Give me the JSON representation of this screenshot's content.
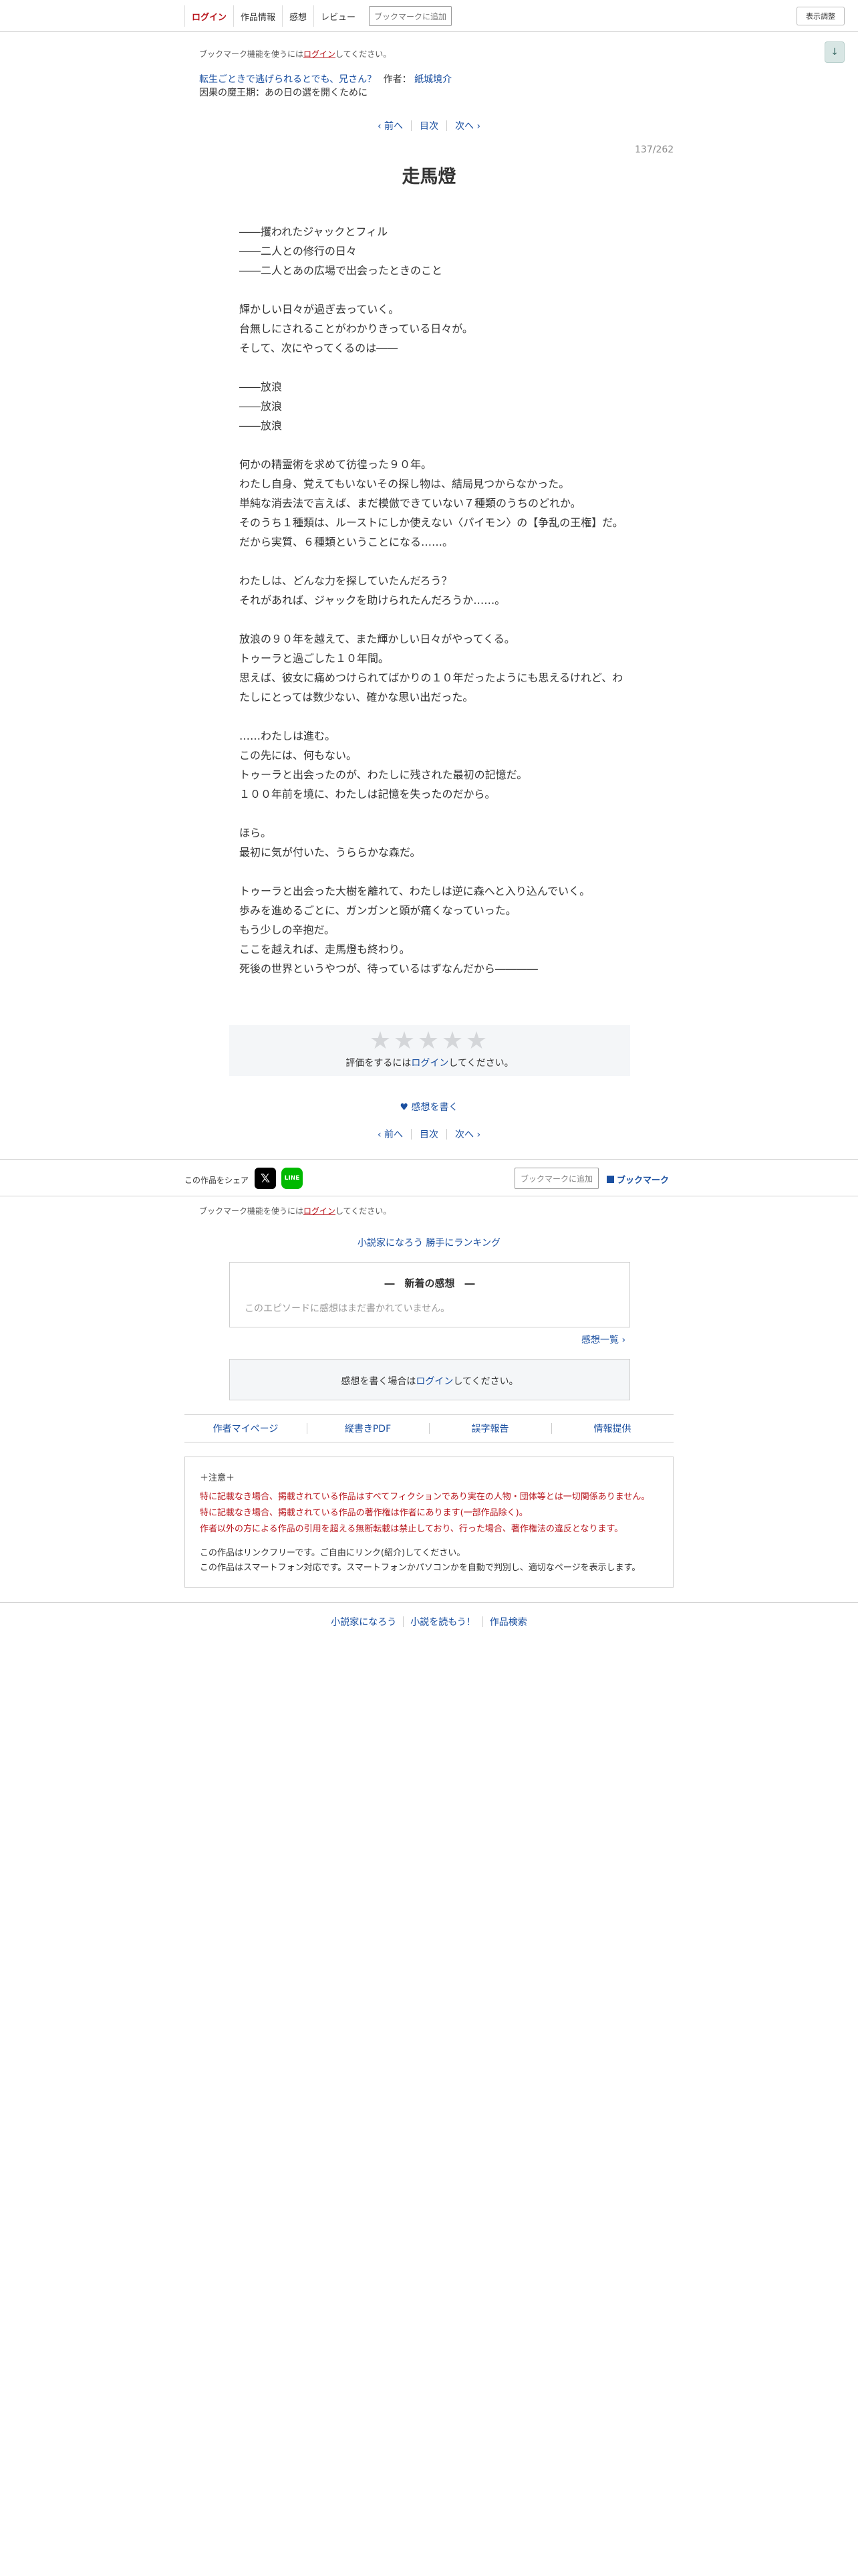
{
  "header": {
    "login": "ログイン",
    "work_info": "作品情報",
    "impressions": "感想",
    "review": "レビュー",
    "bookmark_add": "ブックマークに追加",
    "display_adjust": "表示調整",
    "scroll_arrow": "↓"
  },
  "bookmark_notice": {
    "prefix": "ブックマーク機能を使うには",
    "login": "ログイン",
    "suffix": "してください。"
  },
  "work": {
    "series_title": "転生ごときで逃げられるとでも、兄さん？",
    "author_label": "作者：",
    "author": "紙城境介",
    "chapter": "因果の魔王期：あの日の選を開くために"
  },
  "pager": {
    "prev": "‹ 前へ",
    "toc": "目次",
    "next": "次へ ›"
  },
  "episode": {
    "number": "137/262",
    "title": "走馬燈"
  },
  "body_lines": [
    "――攫われたジャックとフィル",
    "――二人との修行の日々",
    "――二人とあの広場で出会ったときのこと",
    "",
    "輝かしい日々が過ぎ去っていく。",
    "台無しにされることがわかりきっている日々が。",
    "そして、次にやってくるのは――",
    "",
    "――放浪",
    "――放浪",
    "――放浪",
    "",
    "何かの精霊術を求めて彷徨った９０年。",
    "わたし自身、覚えてもいないその探し物は、結局見つからなかった。",
    "単純な消去法で言えば、まだ模倣できていない７種類のうちのどれか。",
    "そのうち１種類は、ルーストにしか使えない〈パイモン〉の【争乱の王権】だ。",
    "だから実質、６種類ということになる……。",
    "",
    "わたしは、どんな力を探していたんだろう？",
    "それがあれば、ジャックを助けられたんだろうか……。",
    "",
    "放浪の９０年を越えて、また輝かしい日々がやってくる。",
    "トゥーラと過ごした１０年間。",
    "思えば、彼女に痛めつけられてばかりの１０年だったようにも思えるけれど、わたしにとっては数少ない、確かな思い出だった。",
    "",
    "……わたしは進む。",
    "この先には、何もない。",
    "トゥーラと出会ったのが、わたしに残された最初の記憶だ。",
    "１００年前を境に、わたしは記憶を失ったのだから。",
    "",
    "ほら。",
    "最初に気が付いた、うららかな森だ。",
    "",
    "トゥーラと出会った大樹を離れて、わたしは逆に森へと入り込んでいく。",
    "歩みを進めるごとに、ガンガンと頭が痛くなっていった。",
    "もう少しの辛抱だ。",
    "ここを越えれば、走馬燈も終わり。",
    "死後の世界というやつが、待っているはずなんだから――――"
  ],
  "rating": {
    "stars": [
      "★",
      "★",
      "★",
      "★",
      "★"
    ],
    "prefix": "評価をするには",
    "login": "ログイン",
    "suffix": "してください。"
  },
  "write_impression": "♥ 感想を書く",
  "share": {
    "label": "この作品をシェア",
    "x_icon": "𝕏",
    "line_icon": "LINE",
    "bookmark_input": "ブックマークに追加",
    "bookmark_link": "ブックマーク"
  },
  "ranking": "小説家になろう 勝手にランキング",
  "latest_impressions": {
    "title": "―　新着の感想　―",
    "empty": "このエピソードに感想はまだ書かれていません。",
    "list_link": "感想一覧 ›"
  },
  "impression_login": {
    "prefix": "感想を書く場合は",
    "login": "ログイン",
    "suffix": "してください。"
  },
  "footer_links": [
    "作者マイページ",
    "縦書きPDF",
    "誤字報告",
    "情報提供"
  ],
  "notice": {
    "heading": "＋注意＋",
    "red_lines": [
      "特に記載なき場合、掲載されている作品はすべてフィクションであり実在の人物・団体等とは一切関係ありません。",
      "特に記載なき場合、掲載されている作品の著作権は作者にあります(一部作品除く)。",
      "作者以外の方による作品の引用を超える無断転載は禁止しており、行った場合、著作権法の違反となります。"
    ],
    "dark_lines": [
      "この作品はリンクフリーです。ご自由にリンク(紹介)してください。",
      "この作品はスマートフォン対応です。スマートフォンかパソコンかを自動で判別し、適切なページを表示します。"
    ]
  },
  "site_footer": [
    "小説家になろう",
    "小説を読もう！",
    "作品検索"
  ]
}
